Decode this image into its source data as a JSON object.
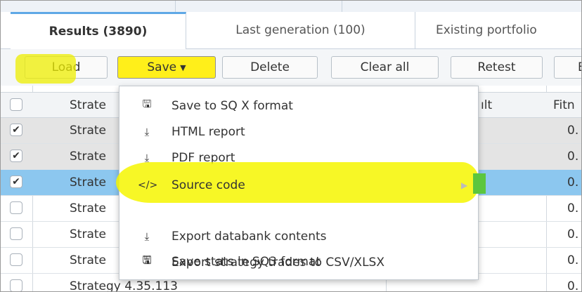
{
  "tabs": [
    {
      "label": "Results (3890)",
      "active": true
    },
    {
      "label": "Last generation (100)",
      "active": false
    },
    {
      "label": "Existing portfolio",
      "active": false
    }
  ],
  "toolbar": {
    "load": "Load",
    "save": "Save",
    "delete": "Delete",
    "clear_all": "Clear all",
    "retest": "Retest",
    "next_partial": "E"
  },
  "table": {
    "headers": {
      "strategy": "Strate",
      "result": "ılt",
      "fitness": "Fitn"
    },
    "rows": [
      {
        "strategy": "Strate",
        "fitness": "0.",
        "checked": true,
        "selected": false
      },
      {
        "strategy": "Strate",
        "fitness": "0.",
        "checked": true,
        "selected": false
      },
      {
        "strategy": "Strate",
        "fitness": "0.",
        "checked": true,
        "selected": true
      },
      {
        "strategy": "Strate",
        "fitness": "0.",
        "checked": false,
        "selected": false
      },
      {
        "strategy": "Strate",
        "fitness": "0.",
        "checked": false,
        "selected": false
      },
      {
        "strategy": "Strate",
        "fitness": "0.",
        "checked": false,
        "selected": false
      },
      {
        "strategy": "Strategy 4.35.113",
        "fitness": "0.",
        "checked": false,
        "selected": false
      }
    ]
  },
  "save_menu": {
    "items": [
      {
        "label": "Save to SQ X format",
        "icon": "floppy-disk-icon"
      },
      {
        "label": "HTML report",
        "icon": "download-icon"
      },
      {
        "label": "PDF report",
        "icon": "download-icon"
      },
      {
        "label": "Source code",
        "icon": "code-icon",
        "submenu": true
      },
      {
        "label": "Export databank contents",
        "icon": "download-icon"
      },
      {
        "label": "Export strategy trades to CSV/XLSX",
        "icon": "floppy-disk-icon"
      },
      {
        "label": "Save stats in SQ3 format",
        "icon": "floppy-disk-icon"
      }
    ],
    "code_glyph": "</>"
  },
  "colors": {
    "highlight": "#f6f600",
    "selected_row": "#8cc7ef",
    "tab_accent": "#5fa8e6",
    "marker_green": "#5cc63e"
  }
}
